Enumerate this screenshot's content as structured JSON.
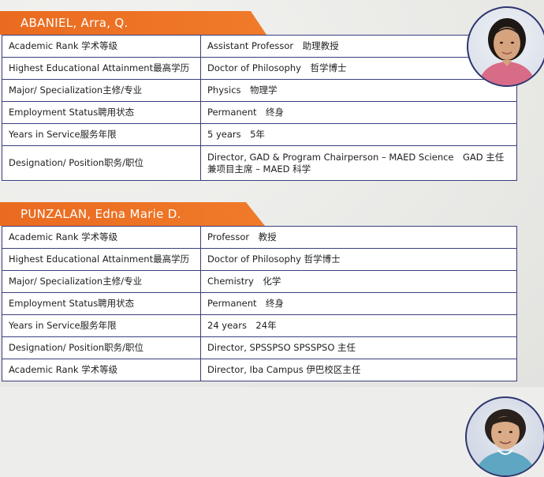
{
  "profiles": [
    {
      "name": "ABANIEL, Arra, Q.",
      "rows": [
        {
          "label": "Academic Rank 学术等级",
          "value": "Assistant Professor　助理教授"
        },
        {
          "label": "Highest Educational Attainment最高学历",
          "value": "Doctor of Philosophy　哲学博士"
        },
        {
          "label": "Major/ Specialization主修/专业",
          "value": "Physics　物理学"
        },
        {
          "label": "Employment Status聘用状态",
          "value": "Permanent　终身"
        },
        {
          "label": "Years in Service服务年限",
          "value": "5 years　5年"
        },
        {
          "label": "Designation/ Position职务/职位",
          "value": "Director, GAD & Program Chairperson – MAED Science　GAD 主任兼项目主席 – MAED 科学"
        }
      ]
    },
    {
      "name": "PUNZALAN, Edna Marie D.",
      "rows": [
        {
          "label": "Academic Rank 学术等级",
          "value": "Professor　教授"
        },
        {
          "label": "Highest Educational Attainment最高学历",
          "value": "Doctor of Philosophy 哲学博士"
        },
        {
          "label": "Major/ Specialization主修/专业",
          "value": "Chemistry　化学"
        },
        {
          "label": "Employment Status聘用状态",
          "value": "Permanent　终身"
        },
        {
          "label": "Years in Service服务年限",
          "value": "24 years　24年"
        },
        {
          "label": "Designation/ Position职务/职位",
          "value": "Director, SPSSPSO SPSSPSO 主任"
        },
        {
          "label": "Academic Rank 学术等级",
          "value": "Director, Iba Campus 伊巴校区主任"
        }
      ]
    }
  ],
  "colors": {
    "header": "#ea6b20",
    "border": "#3b3f7d"
  }
}
